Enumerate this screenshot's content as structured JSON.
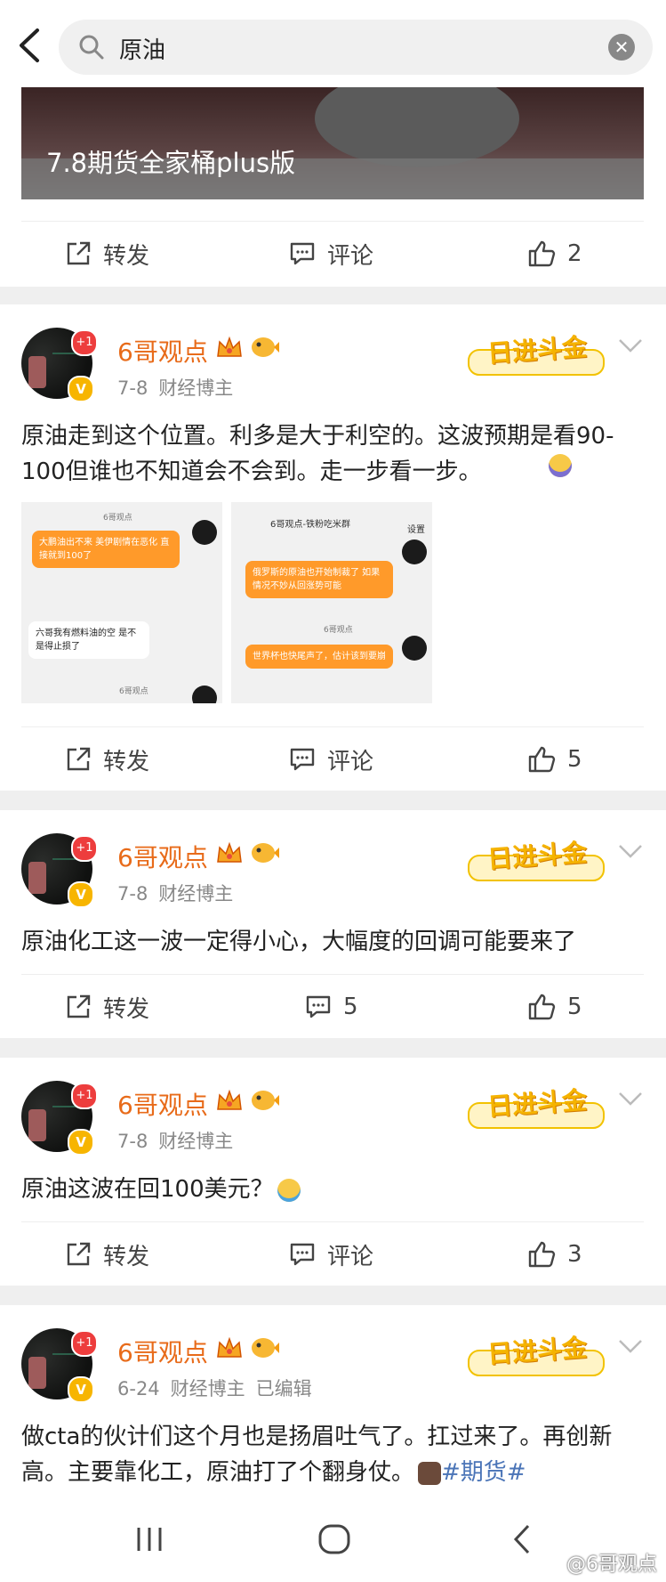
{
  "search": {
    "value": "原油"
  },
  "banner": {
    "caption": "7.8期货全家桶plus版"
  },
  "actions_labels": {
    "repost": "转发",
    "comment": "评论"
  },
  "top_card": {
    "likes": "2"
  },
  "posts": [
    {
      "user": "6哥观点",
      "avatar_badge": "+1",
      "date": "7-8",
      "role": "财经博主",
      "edited": "",
      "text": "原油走到这个位置。利多是大于利空的。这波预期是看90-100但谁也不知道会不会到。走一步看一步。",
      "comment_label": "评论",
      "likes": "5",
      "images": [
        {
          "top_name": "6哥观点",
          "b1": "大鹏油出不来 美伊剧情在恶化 直接就到100了",
          "b2": "六哥我有燃料油的空 是不是得止损了",
          "footer_name": "6哥观点"
        },
        {
          "group_title": "6哥观点-铁粉吃米群",
          "settings": "设置",
          "b1": "俄罗斯的原油也开始制裁了 如果情况不妙从回涨势可能",
          "b2": "世界杯也快尾声了，估计该到要崩",
          "name": "6哥观点"
        }
      ]
    },
    {
      "user": "6哥观点",
      "avatar_badge": "+1",
      "date": "7-8",
      "role": "财经博主",
      "edited": "",
      "text": "原油化工这一波一定得小心，大幅度的回调可能要来了",
      "comment_label": "5",
      "likes": "5"
    },
    {
      "user": "6哥观点",
      "avatar_badge": "+1",
      "date": "7-8",
      "role": "财经博主",
      "edited": "",
      "text": "原油这波在回100美元？",
      "comment_label": "评论",
      "likes": "3"
    },
    {
      "user": "6哥观点",
      "avatar_badge": "+1",
      "date": "6-24",
      "role": "财经博主",
      "edited": "已编辑",
      "text": "做cta的伙计们这个月也是扬眉吐气了。扛过来了。再创新高。主要靠化工，原油打了个翻身仗。",
      "tag": "#期货#"
    }
  ],
  "deco_text": "日进斗金",
  "watermark": "@6哥观点",
  "colors": {
    "username": "#e86b1a",
    "tag": "#4a74b7",
    "badge_gold": "#f7b500",
    "plus_red": "#ed3d3d"
  }
}
